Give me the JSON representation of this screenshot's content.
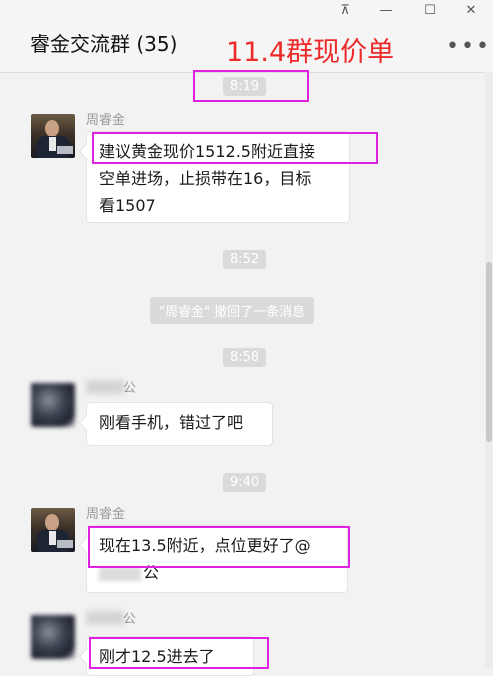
{
  "window": {
    "pin_icon": "pin-icon",
    "minimize_icon": "minimize-icon",
    "maximize_icon": "maximize-icon",
    "close_icon": "close-icon"
  },
  "header": {
    "title": "睿金交流群 (35)",
    "annotation": "11.4群现价单",
    "more_icon": "more-icon"
  },
  "timestamps": [
    "8:19",
    "8:52",
    "8:58",
    "9:40"
  ],
  "system_notice": "\"周睿金\" 撤回了一条消息",
  "messages": [
    {
      "sender": "周睿金",
      "lines": [
        "建议黄金现价1512.5附近直接",
        "空单进场，止损带在16，目标",
        "看1507"
      ]
    },
    {
      "sender_visible": "公",
      "lines": [
        "刚看手机，错过了吧"
      ]
    },
    {
      "sender": "周睿金",
      "lines": [
        "现在13.5附近，点位更好了@",
        "公"
      ]
    },
    {
      "sender_visible": "公",
      "lines": [
        "刚才12.5进去了"
      ]
    }
  ],
  "colors": {
    "annotation_red": "#ee2a2a",
    "highlight_magenta": "#e021e4",
    "background": "#f2f2f2"
  }
}
